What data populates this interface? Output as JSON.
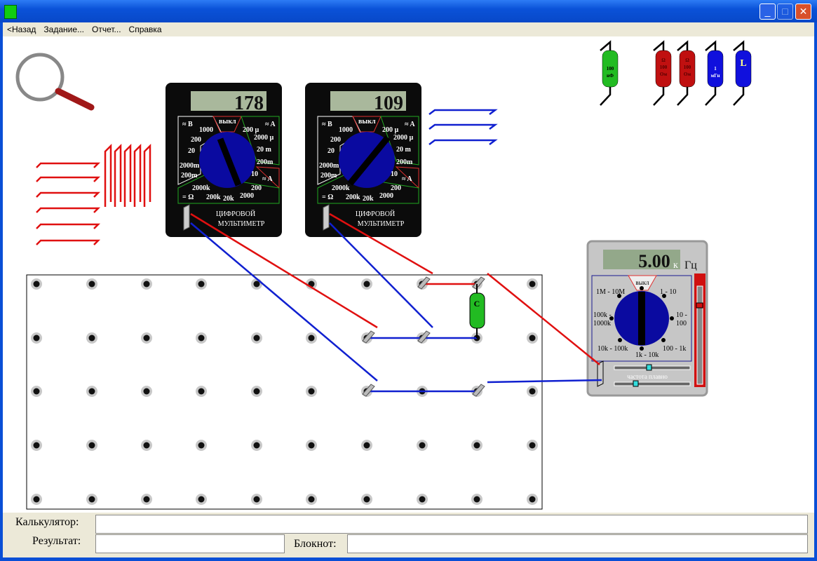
{
  "window": {
    "min": "_",
    "max": "□",
    "close": "✕"
  },
  "menu": [
    "<Назад",
    "Задание...",
    "Отчет...",
    "Справка"
  ],
  "multimeter1": {
    "reading": "178",
    "title1": "ЦИФРОВОЙ",
    "title2": "МУЛЬТИМЕТР"
  },
  "multimeter2": {
    "reading": "109",
    "title1": "ЦИФРОВОЙ",
    "title2": "МУЛЬТИМЕТР"
  },
  "multimeter_labels": [
    "≈ B",
    "1000",
    "200",
    "20",
    "2000m",
    "200m",
    "2000k",
    "= Ω",
    "200k",
    "20k",
    "2000",
    "200",
    "выкл",
    "200 µ",
    "≈ A",
    "2000 µ",
    "20 m",
    "200m",
    "10",
    "≈ A"
  ],
  "generator": {
    "reading": "5.00",
    "prefix": "к",
    "unit": "Гц",
    "off": "выкл",
    "ranges": [
      "1M - 10M",
      "1 - 10",
      "100k -",
      "1000k",
      "10 -",
      "100",
      "10k - 100k",
      "1k - 10k",
      "100 - 1k"
    ],
    "fine_label": "частота плавно"
  },
  "components": {
    "capacitor": [
      "100",
      "нФ"
    ],
    "resistor1": [
      "Ω",
      "100",
      "Ом"
    ],
    "resistor2": [
      "Ω",
      "100",
      "Ом"
    ],
    "inductor1": [
      "1",
      "мГн"
    ],
    "inductor2": [
      "L"
    ],
    "board_capacitor": "C"
  },
  "bottom": {
    "calculator_label": "Калькулятор:",
    "result_label": "Результат:",
    "notepad_label": "Блокнот:",
    "calculator_value": "",
    "result_value": "",
    "notepad_value": ""
  },
  "colors": {
    "red_wire": "#e01010",
    "blue_wire": "#1020d0",
    "dial": "#0a0aa0",
    "lcd": "#a9b89c"
  }
}
